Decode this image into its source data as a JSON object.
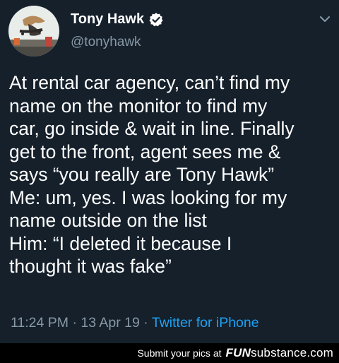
{
  "tweet": {
    "display_name": "Tony Hawk",
    "handle": "@tonyhawk",
    "text": "At rental car agency, can’t find my\nname on the monitor to find my\ncar, go inside & wait in line. Finally\nget to the front, agent sees me &\nsays “you really are Tony Hawk”\nMe: um, yes. I was looking for my\nname outside on the list\nHim: “I deleted it because I\nthought it was fake”",
    "time": "11:24 PM",
    "separator": "·",
    "date": "13 Apr 19",
    "source": "Twitter for iPhone"
  },
  "footer": {
    "text": "Submit your pics at",
    "logo_fun": "FUN",
    "logo_sub": "substance",
    "logo_com": ".com"
  },
  "icons": {
    "verified": "verified-badge-icon",
    "menu": "chevron-down-icon"
  },
  "colors": {
    "background": "#15202b",
    "text": "#ffffff",
    "secondary": "#8899a6",
    "accent": "#1da1f2",
    "footer_bg": "#000000"
  }
}
